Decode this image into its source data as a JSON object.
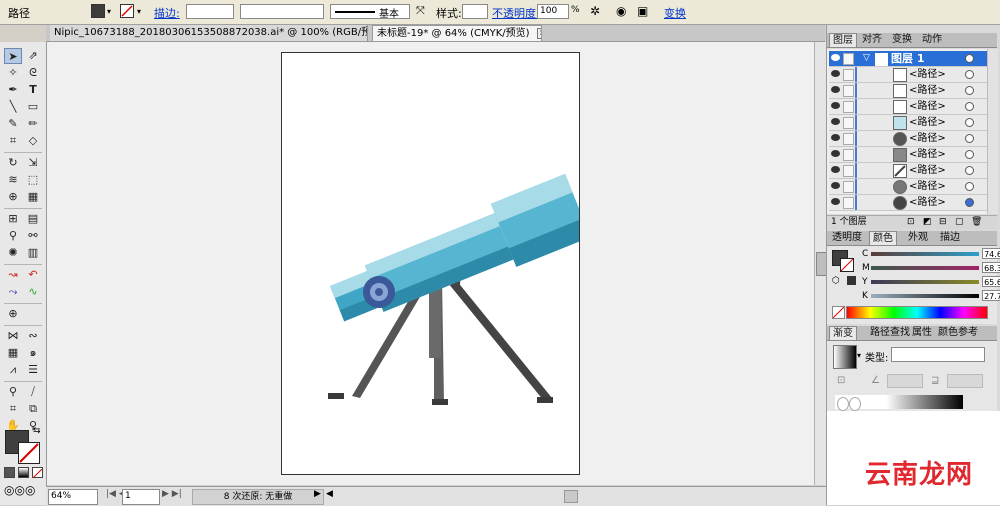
{
  "control_bar": {
    "object_label": "路径",
    "stroke_link": "描边:",
    "brush_label": "基本",
    "style_label": "样式:",
    "opacity_link": "不透明度:",
    "opacity_value": "100",
    "opacity_unit": "%",
    "transform_link": "变换"
  },
  "doc_tabs": [
    {
      "label": "Nipic_10673188_20180306153508872038.ai* @ 100% (RGB/预览)",
      "active": false
    },
    {
      "label": "未标题-19* @ 64% (CMYK/预览)",
      "active": true
    }
  ],
  "status_bar": {
    "zoom": "64%",
    "page": "1",
    "info": "8 次还原: 无重做"
  },
  "layers_panel": {
    "tabs": [
      "图层",
      "对齐",
      "变换",
      "动作"
    ],
    "layer_name": "图层 1",
    "rows": [
      "<路径>",
      "<路径>",
      "<路径>",
      "<路径>",
      "<路径>",
      "<路径>",
      "<路径>",
      "<路径>",
      "<路径>"
    ],
    "footer": "1 个图层"
  },
  "color_panel": {
    "tabs": [
      "透明度",
      "颜色",
      "外观",
      "描边"
    ],
    "channels": [
      {
        "label": "C",
        "value": "74.61"
      },
      {
        "label": "M",
        "value": "68.36"
      },
      {
        "label": "Y",
        "value": "65.63"
      },
      {
        "label": "K",
        "value": "27.73"
      }
    ],
    "unit": "%"
  },
  "gradient_panel": {
    "tabs": [
      "渐变",
      "路径查找",
      "属性",
      "颜色参考"
    ],
    "type_label": "类型:"
  },
  "watermark": "云南龙网",
  "colors": {
    "accent": "#2a6fd6",
    "scope_light": "#a8dbe8",
    "scope_mid": "#56b6d1",
    "scope_dark": "#2d8aa9",
    "tripod": "#4a4a4a",
    "watermark": "#e0282e"
  }
}
